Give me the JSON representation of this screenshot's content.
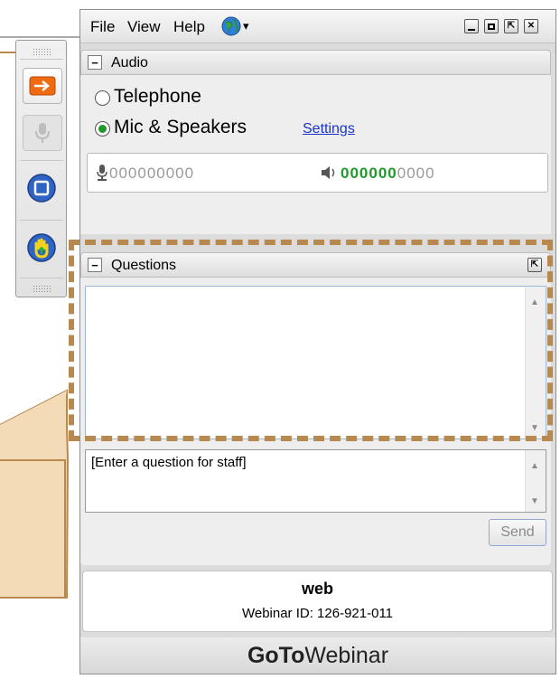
{
  "menu": {
    "file": "File",
    "view": "View",
    "help": "Help",
    "globe_icon": "globe-icon",
    "dropdown_arrow": "▾"
  },
  "window_controls": {
    "minimize": "_",
    "restore": "□",
    "popout": "⇱",
    "close": "✕"
  },
  "audio": {
    "title": "Audio",
    "collapse_glyph": "−",
    "options": [
      {
        "label": "Telephone",
        "selected": false
      },
      {
        "label": "Mic & Speakers",
        "selected": true
      }
    ],
    "settings_link": "Settings",
    "mic_level_text": "000000000",
    "speaker_level_text_active": "000000",
    "speaker_level_text_inactive": "0000",
    "speaker_level_fraction": 0.6
  },
  "questions": {
    "title": "Questions",
    "collapse_glyph": "−",
    "popout_glyph": "⇱",
    "input_placeholder": "[Enter a question for staff]",
    "send_label": "Send"
  },
  "webinar": {
    "name": "web",
    "id_text": "Webinar ID: 126-921-011"
  },
  "brand": {
    "goto": "GoTo",
    "webinar": "Webinar"
  },
  "colors": {
    "callout_fill": "#f3dbb8",
    "callout_border": "#b8894e",
    "dashed_border": "#b8894e",
    "toolbar_orange": "#ef6a10",
    "toolbar_blue": "#2f63c4",
    "link_blue": "#1a33cc",
    "meter_green": "#1e9a2a"
  }
}
